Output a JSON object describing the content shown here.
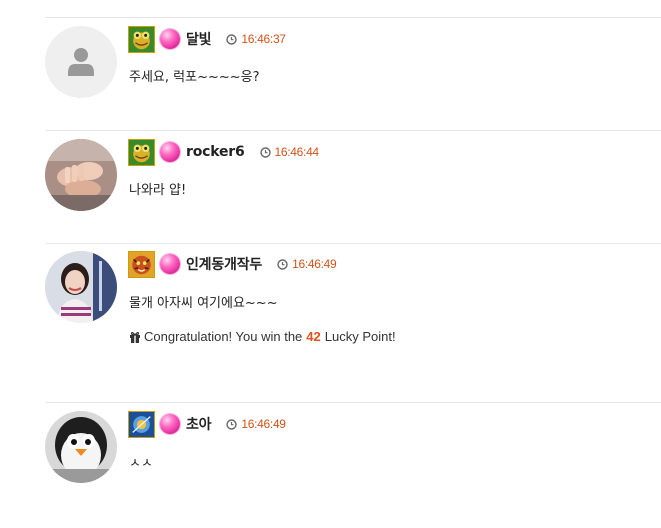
{
  "comments": [
    {
      "nickname": "달빛",
      "time": "16:46:37",
      "message": "주세요, 럭포~~~~응?",
      "avatar": "default-user-icon",
      "level_icon": "level-badge-frog",
      "gem_icon": "pink-gem-icon"
    },
    {
      "nickname": "rocker6",
      "time": "16:46:44",
      "message": "나와라 얍!",
      "avatar": "hands-photo",
      "level_icon": "level-badge-frog",
      "gem_icon": "pink-gem-icon"
    },
    {
      "nickname": "인계동개작두",
      "time": "16:46:49",
      "message": "물개 아자씨 여기에요~~~",
      "avatar": "woman-photo",
      "level_icon": "level-badge-tiger",
      "gem_icon": "pink-gem-icon",
      "lucky": {
        "prefix": "Congratulation! You win the",
        "points": "42",
        "suffix": "Lucky Point!"
      }
    },
    {
      "nickname": "초아",
      "time": "16:46:49",
      "message": "ㅅㅅ",
      "avatar": "penguin-photo",
      "level_icon": "level-badge-blue",
      "gem_icon": "pink-gem-icon"
    }
  ],
  "colors": {
    "time": "#d2521c",
    "points": "#e8501a",
    "divider": "#e8e8e8"
  }
}
